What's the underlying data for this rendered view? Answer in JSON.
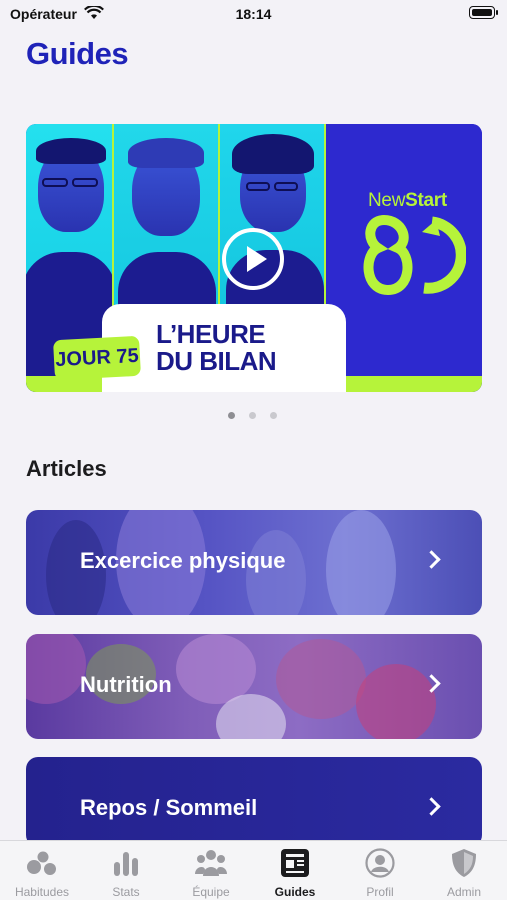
{
  "status_bar": {
    "carrier": "Opérateur",
    "time": "18:14"
  },
  "page_title": "Guides",
  "banner": {
    "brand_new": "New",
    "brand_start": "Start",
    "day_badge": "JOUR 75",
    "title_line1": "L’HEURE",
    "title_line2": "DU BILAN",
    "pager": {
      "count": 3,
      "active": 1
    }
  },
  "articles": {
    "title": "Articles",
    "items": [
      {
        "label": "Excercice physique"
      },
      {
        "label": "Nutrition"
      },
      {
        "label": "Repos / Sommeil"
      }
    ]
  },
  "tabbar": {
    "tabs": [
      {
        "label": "Habitudes",
        "icon": "circles-icon"
      },
      {
        "label": "Stats",
        "icon": "bar-chart-icon"
      },
      {
        "label": "Équipe",
        "icon": "team-icon"
      },
      {
        "label": "Guides",
        "icon": "newspaper-icon",
        "active": true
      },
      {
        "label": "Profil",
        "icon": "person-circle-icon"
      },
      {
        "label": "Admin",
        "icon": "shield-icon"
      }
    ]
  },
  "colors": {
    "accent": "#1f23b8",
    "lime": "#b6f33a",
    "tab_inactive": "#9b9ba0"
  }
}
